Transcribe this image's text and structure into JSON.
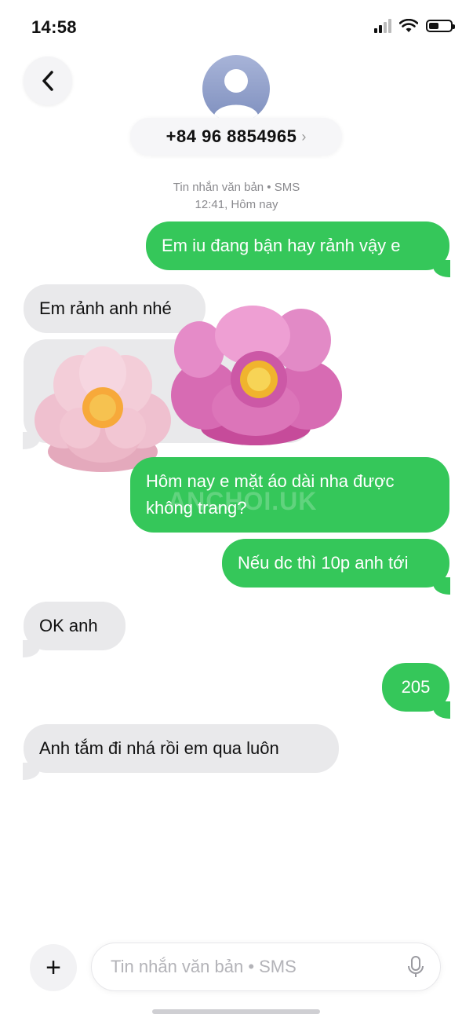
{
  "status_bar": {
    "time": "14:58",
    "battery_level": 0.45
  },
  "header": {
    "contact_number": "+84 96 8854965",
    "chevron": "›",
    "icons": {
      "back": "chevron-left-icon",
      "avatar": "person-icon"
    }
  },
  "thread_meta": {
    "service": "Tin nhắn văn bản • SMS",
    "time": "12:41, Hôm nay"
  },
  "messages": [
    {
      "direction": "out",
      "text": "Em iu đang bận hay rảnh vậy e"
    },
    {
      "direction": "in",
      "text": "Em rảnh anh nhé"
    },
    {
      "direction": "out",
      "text": "Hôm nay e mặt áo dài nha được không trang?"
    },
    {
      "direction": "out",
      "text": "Nếu dc thì 10p anh tới"
    },
    {
      "direction": "in",
      "text": "OK anh"
    },
    {
      "direction": "out",
      "text": "205"
    },
    {
      "direction": "in",
      "text": "Anh tắm đi nhá rồi em qua luôn"
    }
  ],
  "watermark": "ANCHOI.UK",
  "composer": {
    "placeholder": "Tin nhắn văn bản • SMS",
    "plus_label": "+",
    "icons": {
      "mic": "microphone-icon"
    }
  },
  "colors": {
    "outgoing": "#35c75a",
    "incoming": "#e9e9eb",
    "meta": "#8a8a8e"
  }
}
